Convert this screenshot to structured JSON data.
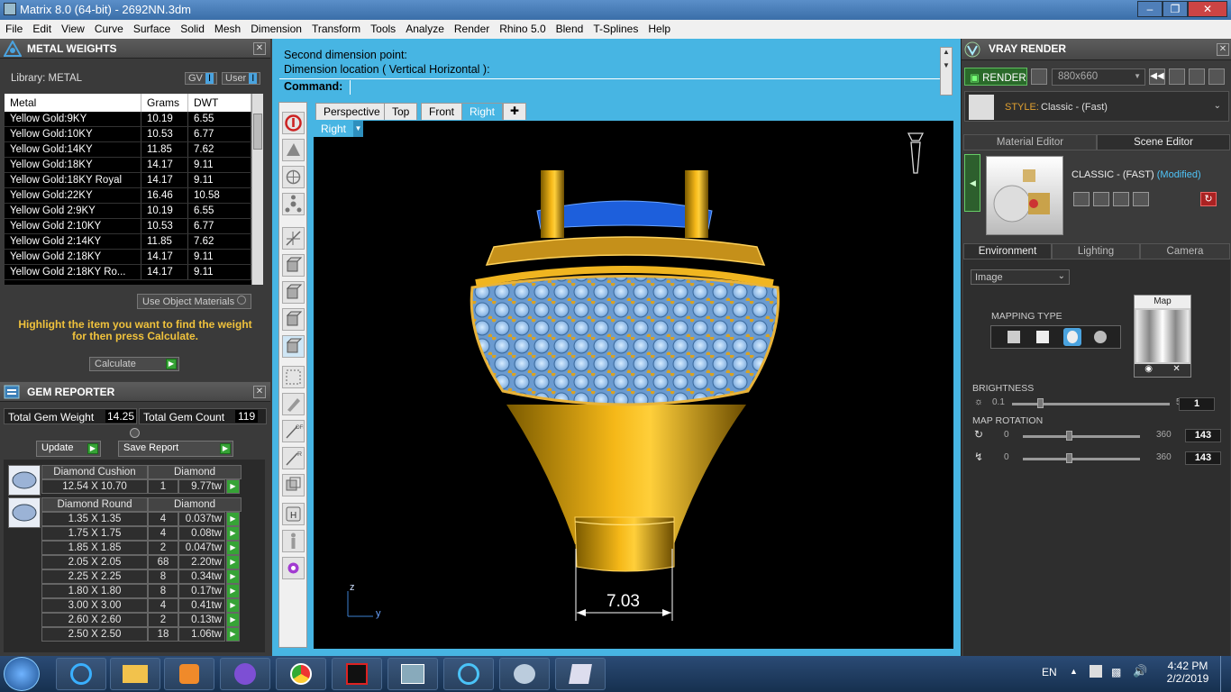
{
  "window": {
    "title": "Matrix 8.0 (64-bit) - 2692NN.3dm"
  },
  "menu": [
    "File",
    "Edit",
    "View",
    "Curve",
    "Surface",
    "Solid",
    "Mesh",
    "Dimension",
    "Transform",
    "Tools",
    "Analyze",
    "Render",
    "Rhino 5.0",
    "Blend",
    "T-Splines",
    "Help"
  ],
  "metal_weights": {
    "title": "METAL WEIGHTS",
    "library_label": "Library: METAL",
    "gv_label": "GV",
    "user_label": "User",
    "columns": [
      "Metal",
      "Grams",
      "DWT"
    ],
    "rows": [
      [
        "Yellow Gold:9KY",
        "10.19",
        "6.55"
      ],
      [
        "Yellow Gold:10KY",
        "10.53",
        "6.77"
      ],
      [
        "Yellow Gold:14KY",
        "11.85",
        "7.62"
      ],
      [
        "Yellow Gold:18KY",
        "14.17",
        "9.11"
      ],
      [
        "Yellow Gold:18KY Royal",
        "14.17",
        "9.11"
      ],
      [
        "Yellow Gold:22KY",
        "16.46",
        "10.58"
      ],
      [
        "Yellow Gold 2:9KY",
        "10.19",
        "6.55"
      ],
      [
        "Yellow Gold 2:10KY",
        "10.53",
        "6.77"
      ],
      [
        "Yellow Gold 2:14KY",
        "11.85",
        "7.62"
      ],
      [
        "Yellow Gold 2:18KY",
        "14.17",
        "9.11"
      ],
      [
        "Yellow Gold 2:18KY Ro...",
        "14.17",
        "9.11"
      ]
    ],
    "use_object_materials": "Use Object Materials",
    "hint": "Highlight the item you want to find the weight for then press Calculate.",
    "calculate_label": "Calculate"
  },
  "gem_reporter": {
    "title": "GEM REPORTER",
    "total_weight_label": "Total Gem Weight",
    "total_weight": "14.25",
    "total_count_label": "Total Gem Count",
    "total_count": "119",
    "update_label": "Update",
    "save_report_label": "Save Report",
    "groups": [
      {
        "shape": "Diamond Cushion",
        "material": "Diamond",
        "rows": [
          [
            "12.54 X 10.70",
            "1",
            "9.77tw"
          ]
        ]
      },
      {
        "shape": "Diamond Round",
        "material": "Diamond",
        "rows": [
          [
            "1.35 X 1.35",
            "4",
            "0.037tw"
          ],
          [
            "1.75 X 1.75",
            "4",
            "0.08tw"
          ],
          [
            "1.85 X 1.85",
            "2",
            "0.047tw"
          ],
          [
            "2.05 X 2.05",
            "68",
            "2.20tw"
          ],
          [
            "2.25 X 2.25",
            "8",
            "0.34tw"
          ],
          [
            "1.80 X 1.80",
            "8",
            "0.17tw"
          ],
          [
            "3.00 X 3.00",
            "4",
            "0.41tw"
          ],
          [
            "2.60 X 2.60",
            "2",
            "0.13tw"
          ],
          [
            "2.50 X 2.50",
            "18",
            "1.06tw"
          ]
        ]
      }
    ]
  },
  "command": {
    "line1": "Second dimension point:",
    "line2": "Dimension location ( Vertical  Horizontal ):",
    "prompt": "Command:"
  },
  "viewport": {
    "tabs": [
      "Perspective",
      "Top",
      "Front",
      "Right"
    ],
    "active_tab": "Right",
    "view_label": "Right",
    "dimension": "7.03",
    "axis_z": "z",
    "axis_y": "y"
  },
  "vray": {
    "title": "VRAY RENDER",
    "render_label": "RENDER",
    "resolution": "880x660",
    "style_label": "STYLE:",
    "style_value": "Classic - (Fast)",
    "tabs": [
      "Material Editor",
      "Scene Editor"
    ],
    "scene_name": "CLASSIC - (FAST)",
    "scene_modified": "(Modified)",
    "env_tabs": [
      "Environment",
      "Lighting",
      "Camera"
    ],
    "image_select": "Image",
    "mapping_type_label": "MAPPING TYPE",
    "map_label": "Map",
    "brightness_label": "BRIGHTNESS",
    "brightness_min": "0.1",
    "brightness_max": "5",
    "brightness_value": "1",
    "map_rotation_label": "MAP ROTATION",
    "rot1_min": "0",
    "rot1_max": "360",
    "rot1_value": "143",
    "rot2_min": "0",
    "rot2_max": "360",
    "rot2_value": "143"
  },
  "taskbar": {
    "lang": "EN",
    "time": "4:42 PM",
    "date": "2/2/2019"
  }
}
